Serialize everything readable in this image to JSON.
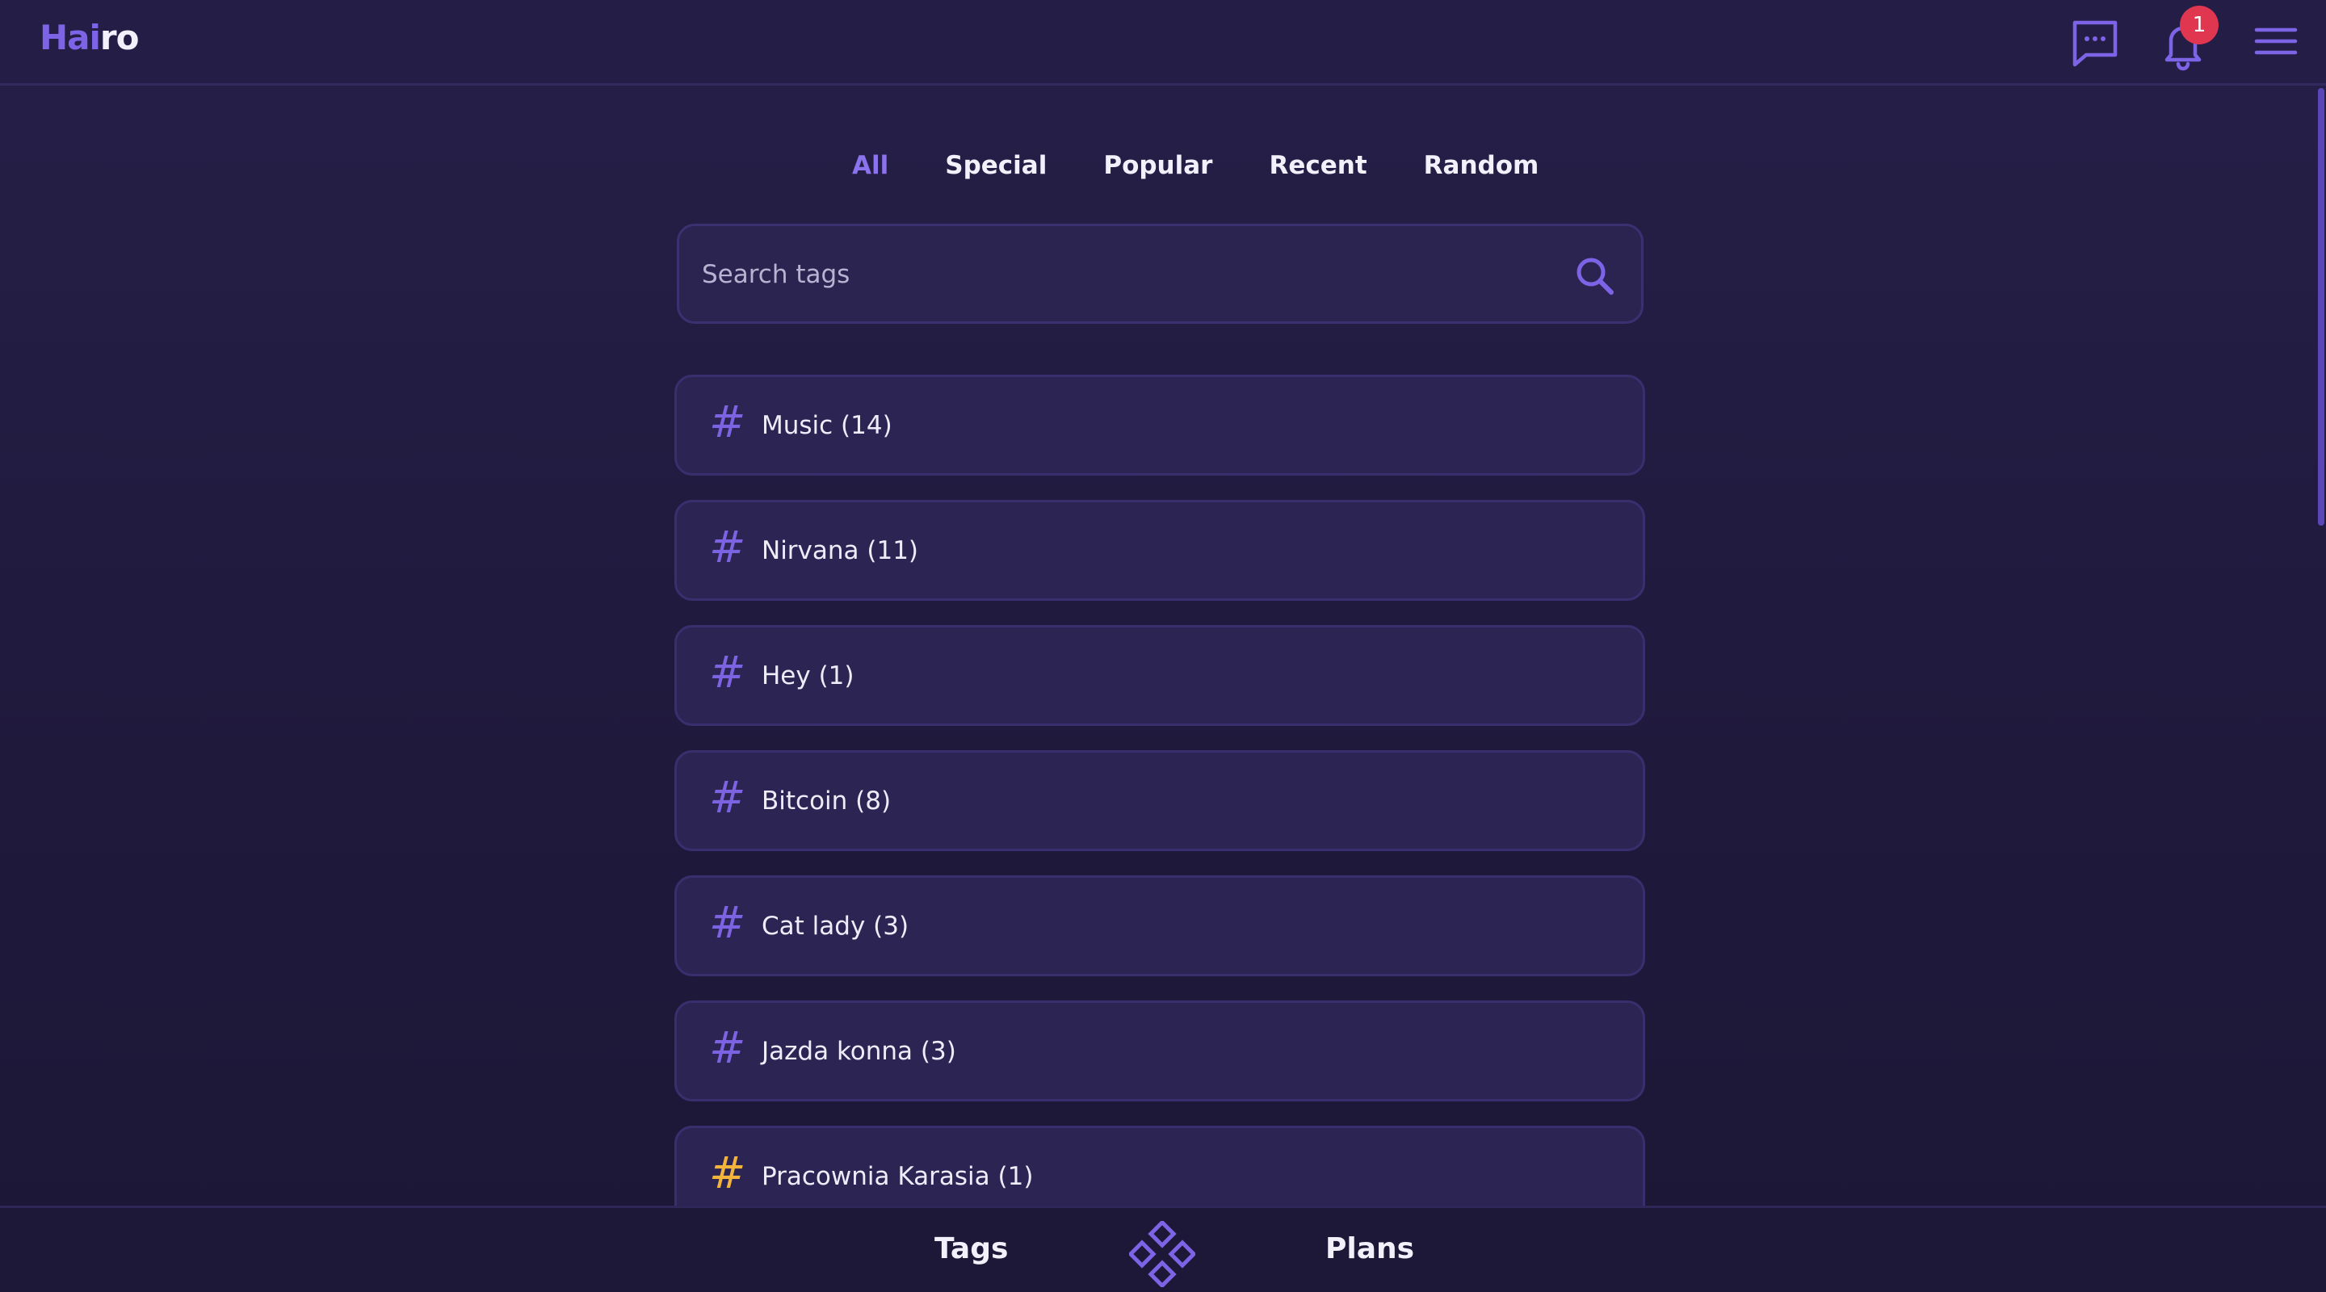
{
  "header": {
    "logo_part1": "Hai",
    "logo_part2": "ro",
    "notification_count": "1",
    "icons": [
      "chat-icon",
      "bell-icon",
      "menu-icon"
    ]
  },
  "filter_tabs": [
    {
      "label": "All",
      "active": true
    },
    {
      "label": "Special",
      "active": false
    },
    {
      "label": "Popular",
      "active": false
    },
    {
      "label": "Recent",
      "active": false
    },
    {
      "label": "Random",
      "active": false
    }
  ],
  "search": {
    "placeholder": "Search tags"
  },
  "tags": [
    {
      "label": "Music (14)",
      "hash_color": "#7b63e2"
    },
    {
      "label": "Nirvana (11)",
      "hash_color": "#7b63e2"
    },
    {
      "label": "Hey (1)",
      "hash_color": "#7b63e2"
    },
    {
      "label": "Bitcoin (8)",
      "hash_color": "#7b63e2"
    },
    {
      "label": "Cat lady (3)",
      "hash_color": "#7b63e2"
    },
    {
      "label": "Jazda konna (3)",
      "hash_color": "#7b63e2"
    },
    {
      "label": "Pracownia Karasia (1)",
      "hash_color": "#f2b43a"
    }
  ],
  "hash_symbol": "#",
  "bottom_nav": {
    "tags_label": "Tags",
    "plans_label": "Plans"
  },
  "colors": {
    "accent": "#7d64e6",
    "badge": "#e0364f",
    "background": "#211b3f",
    "special_tag": "#f2b43a"
  }
}
